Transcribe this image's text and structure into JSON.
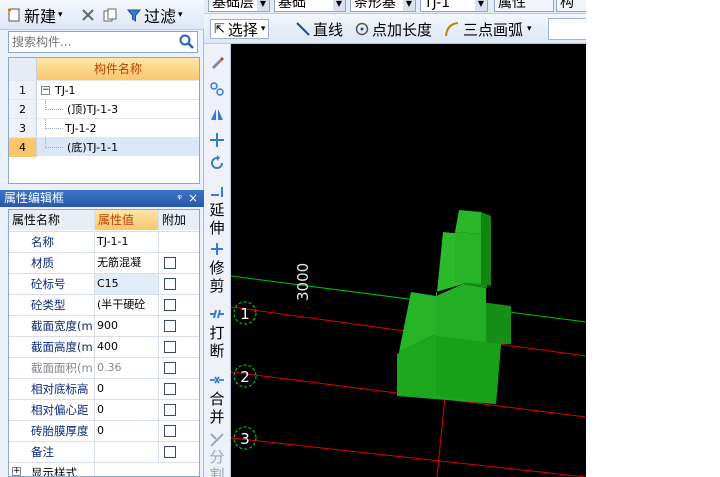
{
  "toolbar": {
    "new_label": "新建",
    "filter_label": "过滤"
  },
  "search": {
    "placeholder": "搜索构件..."
  },
  "tree": {
    "header": "构件名称",
    "rows": [
      {
        "num": "1",
        "label": "TJ-1"
      },
      {
        "num": "2",
        "label": "(顶)TJ-1-3"
      },
      {
        "num": "3",
        "label": "TJ-1-2"
      },
      {
        "num": "4",
        "label": "(底)TJ-1-1"
      }
    ]
  },
  "prop_panel": {
    "title": "属性编辑框",
    "pin": "ᵠ",
    "close": "×",
    "headers": {
      "name": "属性名称",
      "value": "属性值",
      "extra": "附加"
    },
    "rows": [
      {
        "name": "名称",
        "value": "TJ-1-1"
      },
      {
        "name": "材质",
        "value": "无筋混凝"
      },
      {
        "name": "砼标号",
        "value": "C15"
      },
      {
        "name": "砼类型",
        "value": "(半干硬砼"
      },
      {
        "name": "截面宽度(m",
        "value": "900"
      },
      {
        "name": "截面高度(m",
        "value": "400"
      },
      {
        "name": "截面面积(m",
        "value": "0.36"
      },
      {
        "name": "相对底标高",
        "value": "0"
      },
      {
        "name": "相对偏心距",
        "value": "0"
      },
      {
        "name": "砖胎膜厚度",
        "value": "0"
      },
      {
        "name": "备注",
        "value": ""
      },
      {
        "name": "显示样式",
        "value": ""
      }
    ]
  },
  "top_bar1": {
    "combo1": "基础层",
    "combo2": "基础",
    "combo3": "条形基",
    "combo4": "TJ-1",
    "props_button": "属性",
    "extra_button": "构"
  },
  "top_bar2": {
    "select": "选择",
    "line": "直线",
    "point_length": "点加长度",
    "arc": "三点画弧"
  },
  "vertical_tools": {
    "extend": [
      "延",
      "伸"
    ],
    "trim": [
      "修",
      "剪"
    ],
    "break": [
      "打",
      "断"
    ],
    "merge": [
      "合",
      "并"
    ],
    "split": [
      "分",
      "割"
    ]
  },
  "canvas": {
    "dimension_label": "3000",
    "axis_labels": [
      "1",
      "2",
      "3"
    ]
  },
  "colors": {
    "accent_orange": "#f9c76a",
    "title_blue": "#2958a8",
    "solid_green": "#1faa1f",
    "axis_red": "#e00000",
    "axis_green": "#00c000"
  }
}
